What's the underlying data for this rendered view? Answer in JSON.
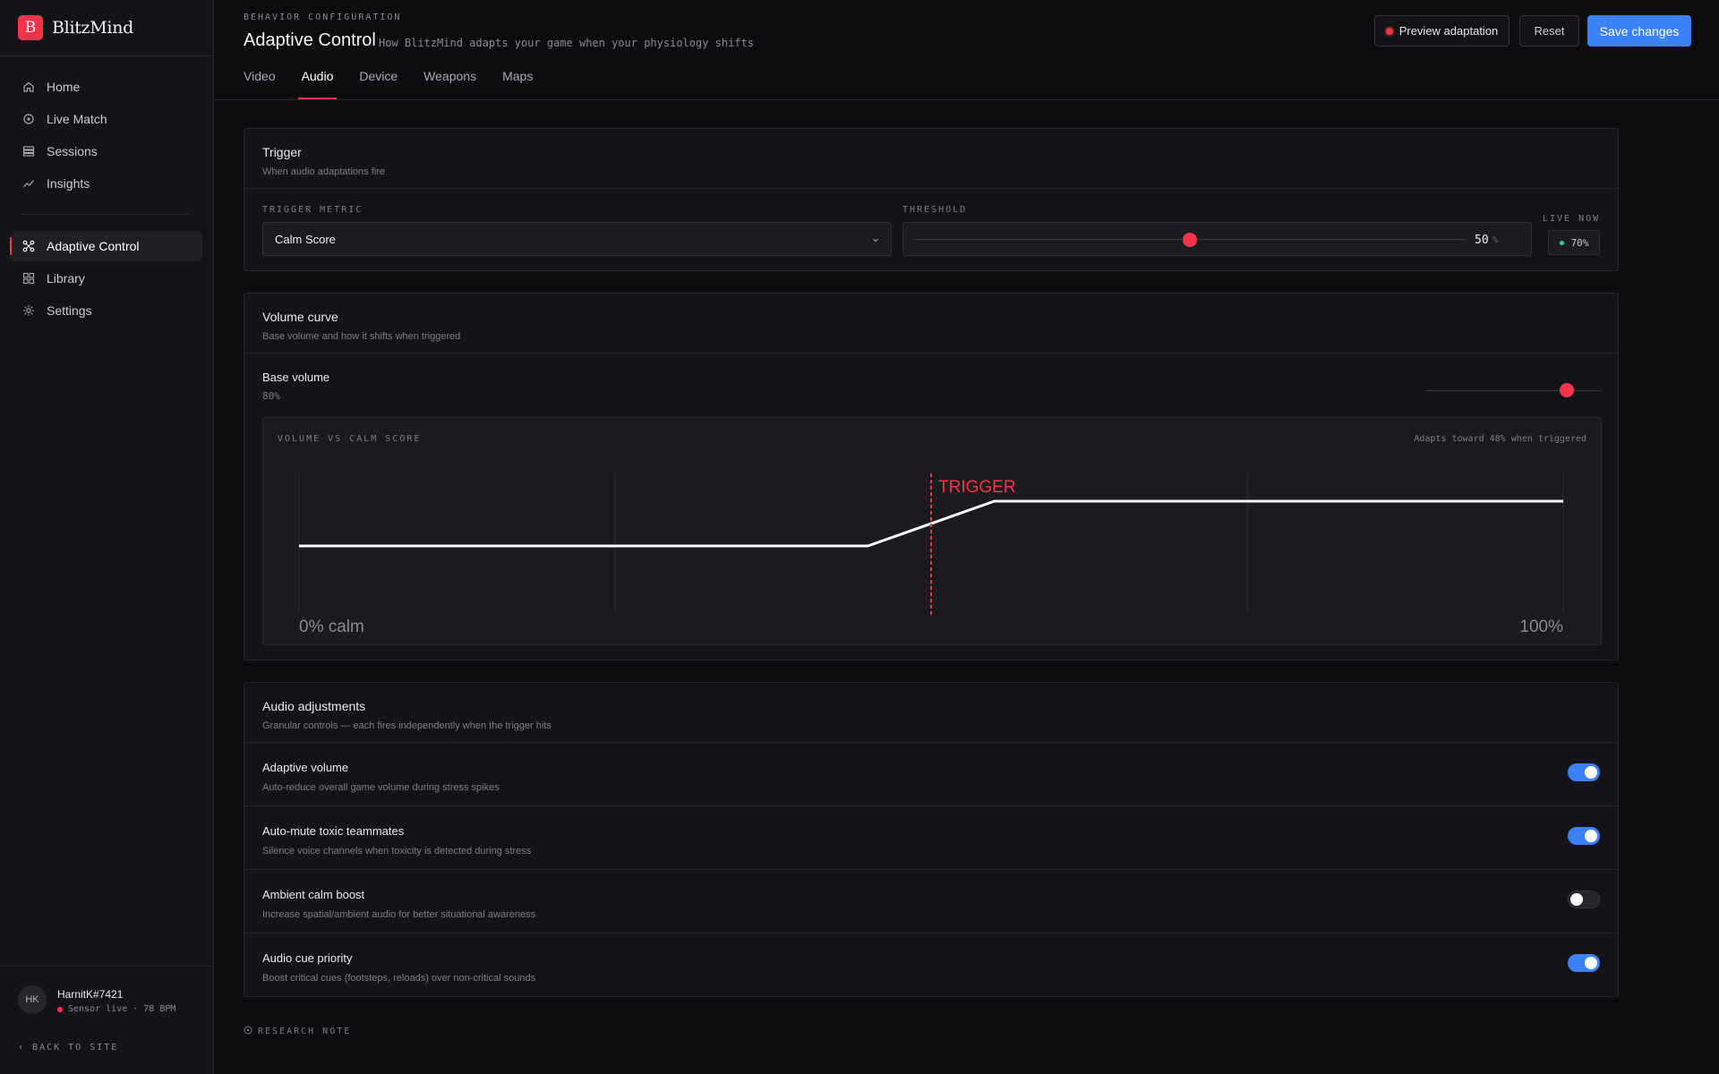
{
  "brand": {
    "logo_letter": "B",
    "name": "BlitzMind"
  },
  "nav": {
    "primary": [
      {
        "label": "Home",
        "icon": "home-icon"
      },
      {
        "label": "Live Match",
        "icon": "target-icon"
      },
      {
        "label": "Sessions",
        "icon": "stack-icon"
      },
      {
        "label": "Insights",
        "icon": "trend-icon"
      }
    ],
    "secondary": [
      {
        "label": "Adaptive Control",
        "icon": "nodes-icon",
        "active": true
      },
      {
        "label": "Library",
        "icon": "grid-icon"
      },
      {
        "label": "Settings",
        "icon": "gear-icon"
      }
    ]
  },
  "user": {
    "initials": "HK",
    "name": "HarnitK#7421",
    "status": "Sensor live · 78 BPM",
    "back_label": "BACK TO SITE"
  },
  "header": {
    "eyebrow": "BEHAVIOR CONFIGURATION",
    "title": "Adaptive Control",
    "subtitle": "How BlitzMind adapts your game when your physiology shifts",
    "preview_label": "Preview adaptation",
    "reset_label": "Reset",
    "save_label": "Save changes"
  },
  "tabs": [
    {
      "label": "Video"
    },
    {
      "label": "Audio",
      "active": true
    },
    {
      "label": "Device"
    },
    {
      "label": "Weapons"
    },
    {
      "label": "Maps"
    }
  ],
  "trigger": {
    "title": "Trigger",
    "subtitle": "When audio adaptations fire",
    "metric_label": "TRIGGER METRIC",
    "metric_value": "Calm Score",
    "threshold_label": "THRESHOLD",
    "threshold_value": "50",
    "threshold_unit": "%",
    "threshold_fraction": 0.5,
    "live_label": "LIVE NOW",
    "live_value": "70%"
  },
  "volume": {
    "title": "Volume curve",
    "subtitle": "Base volume and how it shifts when triggered",
    "base_label": "Base volume",
    "base_value": "80%",
    "base_fraction": 0.8
  },
  "chart_data": {
    "type": "line",
    "title": "VOLUME VS CALM SCORE",
    "note": "Adapts toward 48% when triggered",
    "x_start_label": "0% calm",
    "x_end_label": "100%",
    "trigger_label": "TRIGGER",
    "trigger_x": 50,
    "xlim": [
      0,
      100
    ],
    "ylim": [
      0,
      100
    ],
    "series": [
      {
        "x": [
          0,
          45,
          55,
          100
        ],
        "y": [
          48,
          48,
          80,
          80
        ]
      }
    ],
    "colors": {
      "line": "#ffffff",
      "trigger": "#f5364a"
    }
  },
  "adjustments": {
    "title": "Audio adjustments",
    "subtitle": "Granular controls — each fires independently when the trigger hits",
    "items": [
      {
        "title": "Adaptive volume",
        "desc": "Auto-reduce overall game volume during stress spikes",
        "on": true
      },
      {
        "title": "Auto-mute toxic teammates",
        "desc": "Silence voice channels when toxicity is detected during stress",
        "on": true
      },
      {
        "title": "Ambient calm boost",
        "desc": "Increase spatial/ambient audio for better situational awareness",
        "on": false
      },
      {
        "title": "Audio cue priority",
        "desc": "Boost critical cues (footsteps, reloads) over non-critical sounds",
        "on": true
      }
    ]
  },
  "research_note": "RESEARCH NOTE",
  "colors": {
    "accent": "#f5364a",
    "primary": "#3b82f6",
    "live": "#34d399"
  }
}
